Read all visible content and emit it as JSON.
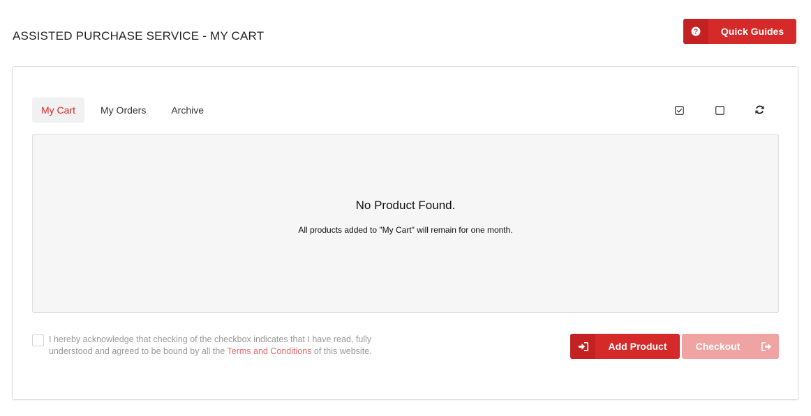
{
  "header": {
    "title": "ASSISTED PURCHASE SERVICE - MY CART",
    "quick_guides_label": "Quick Guides",
    "quick_guides_icon": "question-circle-icon"
  },
  "tabs": [
    {
      "label": "My Cart",
      "active": true
    },
    {
      "label": "My Orders",
      "active": false
    },
    {
      "label": "Archive",
      "active": false
    }
  ],
  "toolbar": {
    "icons": [
      "check-square-icon",
      "square-icon",
      "refresh-icon"
    ]
  },
  "empty_state": {
    "title": "No Product Found.",
    "subtitle": "All products added to \"My Cart\" will remain for one month."
  },
  "acknowledgement": {
    "text_before": "I hereby acknowledge that checking of the checkbox indicates that I have read, fully understood and agreed to be bound by all the ",
    "link_text": "Terms and Conditions",
    "text_after": " of this website.",
    "checked": false
  },
  "actions": {
    "add_product_label": "Add Product",
    "add_product_icon": "sign-in-icon",
    "checkout_label": "Checkout",
    "checkout_icon": "sign-out-icon"
  },
  "colors": {
    "accent": "#d62a2a",
    "accent_dark": "#c42222",
    "disabled_accent": "#efa3a3",
    "link": "#e46a6a"
  }
}
